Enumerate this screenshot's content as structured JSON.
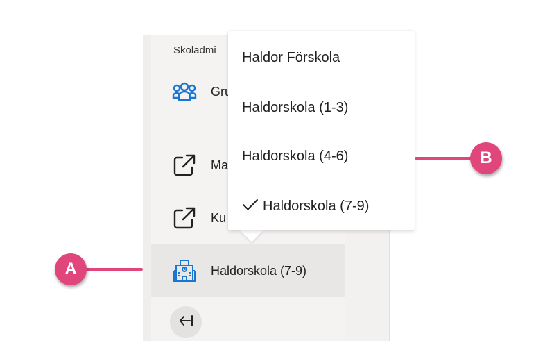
{
  "sidebar": {
    "section_label": "Skoladmi",
    "items": [
      {
        "label": "Grupper",
        "icon": "groups-icon"
      },
      {
        "label": "Ma",
        "icon": "external-link-icon"
      },
      {
        "label": "Ku",
        "icon": "external-link-icon"
      }
    ],
    "school_selector": {
      "label": "Haldorskola (7-9)",
      "icon": "school-building-icon"
    },
    "collapse_icon": "collapse-left-icon"
  },
  "dropdown": {
    "options": [
      {
        "label": "Haldor Förskola",
        "selected": false
      },
      {
        "label": "Haldorskola (1-3)",
        "selected": false
      },
      {
        "label": "Haldorskola (4-6)",
        "selected": false
      },
      {
        "label": "Haldorskola (7-9)",
        "selected": true
      }
    ],
    "check_icon": "checkmark-icon"
  },
  "callouts": {
    "a": "A",
    "b": "B"
  },
  "colors": {
    "accent": "#e0467c",
    "icon_blue": "#1976d2",
    "sidebar_bg": "#f4f3f2",
    "selected_bg": "#e8e7e6"
  }
}
